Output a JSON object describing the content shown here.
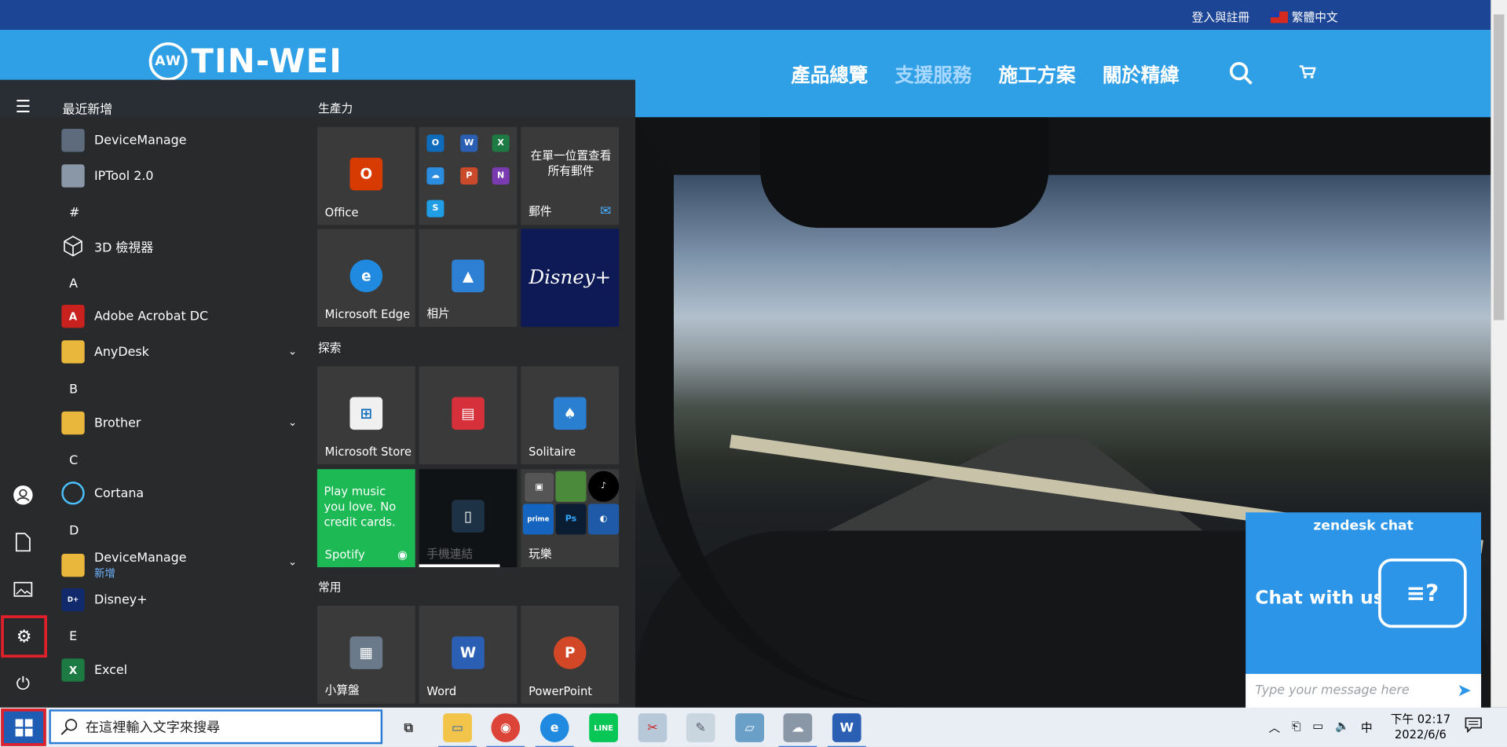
{
  "website": {
    "top_bar": {
      "login": "登入與註冊",
      "language": "繁體中文"
    },
    "logo": "TIN-WEI",
    "logo_badge": "AW",
    "nav": [
      {
        "label": "產品總覽",
        "active": false
      },
      {
        "label": "支援服務",
        "active": true
      },
      {
        "label": "施工方案",
        "active": false
      },
      {
        "label": "關於精緯",
        "active": false
      }
    ],
    "chat": {
      "brand": "zendesk chat",
      "title": "Chat with us",
      "placeholder": "Type your message here"
    }
  },
  "start_menu": {
    "list_header": "最近新增",
    "recent": [
      {
        "label": "DeviceManage",
        "icon": "device-manage-icon"
      },
      {
        "label": "IPTool 2.0",
        "icon": "iptool-icon"
      }
    ],
    "sections": [
      {
        "letter": "#",
        "apps": [
          {
            "label": "3D 檢視器",
            "icon": "cube-icon"
          }
        ]
      },
      {
        "letter": "A",
        "apps": [
          {
            "label": "Adobe Acrobat DC",
            "icon": "acrobat-icon"
          },
          {
            "label": "AnyDesk",
            "icon": "folder-icon",
            "expand": true
          }
        ]
      },
      {
        "letter": "B",
        "apps": [
          {
            "label": "Brother",
            "icon": "folder-icon",
            "expand": true
          }
        ]
      },
      {
        "letter": "C",
        "apps": [
          {
            "label": "Cortana",
            "icon": "cortana-icon"
          }
        ]
      },
      {
        "letter": "D",
        "apps": [
          {
            "label": "DeviceManage",
            "sub": "新增",
            "icon": "folder-icon",
            "expand": true
          },
          {
            "label": "Disney+",
            "icon": "disney-icon"
          }
        ]
      },
      {
        "letter": "E",
        "apps": [
          {
            "label": "Excel",
            "icon": "excel-icon"
          }
        ]
      }
    ],
    "groups": [
      {
        "title": "生產力",
        "tiles": [
          {
            "label": "Office",
            "icon": "office-icon"
          },
          {
            "label": "",
            "icon": "office-apps-icon"
          },
          {
            "label": "郵件",
            "text": "在單一位置查看所有郵件",
            "icon": "mail-icon"
          },
          {
            "label": "Microsoft Edge",
            "icon": "edge-icon"
          },
          {
            "label": "相片",
            "icon": "photos-icon"
          },
          {
            "label": "",
            "icon": "disney-plus-icon",
            "brand": "Disney+"
          }
        ]
      },
      {
        "title": "探索",
        "tiles": [
          {
            "label": "Microsoft Store",
            "icon": "store-icon"
          },
          {
            "label": "",
            "icon": "news-icon"
          },
          {
            "label": "Solitaire",
            "icon": "solitaire-icon"
          },
          {
            "label": "Spotify",
            "text": "Play music you love. No credit cards.",
            "icon": "spotify-icon"
          },
          {
            "label": "手機連結",
            "icon": "phone-link-icon"
          },
          {
            "label": "玩樂",
            "icon": "play-folder-icon"
          }
        ]
      },
      {
        "title": "常用",
        "tiles": [
          {
            "label": "小算盤",
            "icon": "calculator-icon"
          },
          {
            "label": "Word",
            "icon": "word-icon"
          },
          {
            "label": "PowerPoint",
            "icon": "powerpoint-icon"
          }
        ]
      }
    ]
  },
  "taskbar": {
    "search_placeholder": "在這裡輸入文字來搜尋",
    "ime": "中",
    "time": "下午 02:17",
    "date": "2022/6/6"
  },
  "colors": {
    "site_top": "#1c4596",
    "site_nav": "#2f9fe6",
    "highlight": "#e0202a",
    "zendesk": "#2d95e8"
  }
}
